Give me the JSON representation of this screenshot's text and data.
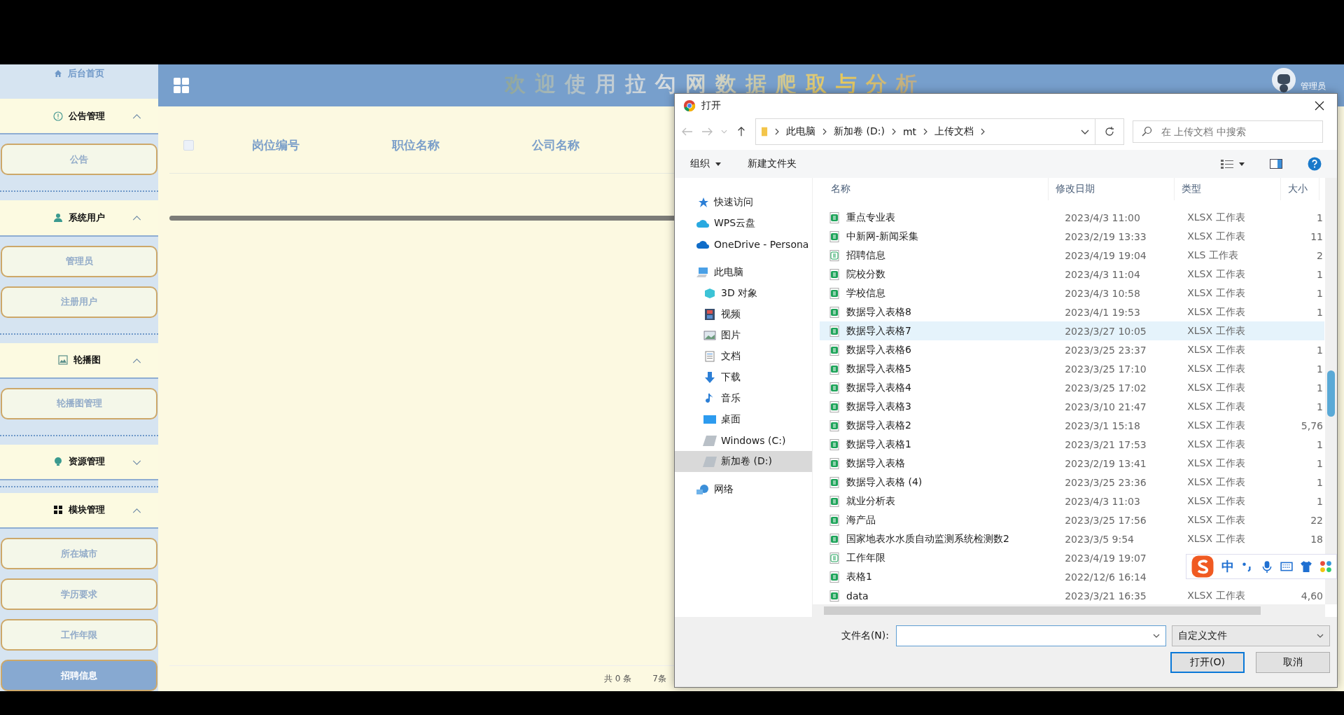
{
  "sidebar": {
    "home": {
      "label": "后台首页"
    },
    "groups": [
      {
        "label": "公告管理",
        "expanded": true,
        "children": [
          {
            "label": "公告",
            "selected": false
          }
        ]
      },
      {
        "label": "系统用户",
        "expanded": true,
        "children": [
          {
            "label": "管理员",
            "selected": false
          },
          {
            "label": "注册用户",
            "selected": false
          }
        ]
      },
      {
        "label": "轮播图",
        "expanded": true,
        "children": [
          {
            "label": "轮播图管理",
            "selected": false
          }
        ]
      },
      {
        "label": "资源管理",
        "expanded": false
      },
      {
        "label": "模块管理",
        "expanded": true,
        "children": [
          {
            "label": "所在城市",
            "selected": false
          },
          {
            "label": "学历要求",
            "selected": false
          },
          {
            "label": "工作年限",
            "selected": false
          },
          {
            "label": "招聘信息",
            "selected": true
          }
        ]
      }
    ]
  },
  "header": {
    "title": "欢迎使用拉勾网数据爬取与分析",
    "user": "管理员"
  },
  "table": {
    "columns": [
      "岗位编号",
      "职位名称",
      "公司名称"
    ],
    "select_all": {
      "checked": false
    }
  },
  "pagination": {
    "total": "共 0 条",
    "page_size": "7条"
  },
  "dialog": {
    "title": "打开",
    "breadcrumb": [
      "此电脑",
      "新加卷 (D:)",
      "mt",
      "上传文档"
    ],
    "search_placeholder": "在 上传文档 中搜索",
    "toolbar": {
      "organize": "组织",
      "new_folder": "新建文件夹"
    },
    "nav": [
      {
        "label": "快速访问",
        "selected": false
      },
      {
        "label": "WPS云盘",
        "selected": false
      },
      {
        "label": "OneDrive - Persona",
        "selected": false
      },
      {
        "label": "此电脑",
        "selected": false,
        "children": [
          {
            "label": "3D 对象",
            "selected": false
          },
          {
            "label": "视频",
            "selected": false
          },
          {
            "label": "图片",
            "selected": false
          },
          {
            "label": "文档",
            "selected": false
          },
          {
            "label": "下载",
            "selected": false
          },
          {
            "label": "音乐",
            "selected": false
          },
          {
            "label": "桌面",
            "selected": false
          },
          {
            "label": "Windows (C:)",
            "selected": false
          },
          {
            "label": "新加卷 (D:)",
            "selected": true
          }
        ]
      },
      {
        "label": "网络",
        "selected": false
      }
    ],
    "columns": [
      "名称",
      "修改日期",
      "类型",
      "大小"
    ],
    "files": [
      {
        "name": "重点专业表",
        "date": "2023/4/3 11:00",
        "type": "XLSX 工作表",
        "size": "1",
        "kind": "xlsx",
        "selected": false
      },
      {
        "name": "中新网-新闻采集",
        "date": "2023/2/19 13:33",
        "type": "XLSX 工作表",
        "size": "11",
        "kind": "xlsx",
        "selected": false
      },
      {
        "name": "招聘信息",
        "date": "2023/4/19 19:04",
        "type": "XLS 工作表",
        "size": "2",
        "kind": "xls",
        "selected": false
      },
      {
        "name": "院校分数",
        "date": "2023/4/3 11:04",
        "type": "XLSX 工作表",
        "size": "1",
        "kind": "xlsx",
        "selected": false
      },
      {
        "name": "学校信息",
        "date": "2023/4/3 10:58",
        "type": "XLSX 工作表",
        "size": "1",
        "kind": "xlsx",
        "selected": false
      },
      {
        "name": "数据导入表格8",
        "date": "2023/4/1 19:53",
        "type": "XLSX 工作表",
        "size": "1",
        "kind": "xlsx",
        "selected": false
      },
      {
        "name": "数据导入表格7",
        "date": "2023/3/27 10:05",
        "type": "XLSX 工作表",
        "kind": "xlsx",
        "selected": true
      },
      {
        "name": "数据导入表格6",
        "date": "2023/3/25 23:37",
        "type": "XLSX 工作表",
        "size": "1",
        "kind": "xlsx",
        "selected": false
      },
      {
        "name": "数据导入表格5",
        "date": "2023/3/25 17:10",
        "type": "XLSX 工作表",
        "size": "1",
        "kind": "xlsx",
        "selected": false
      },
      {
        "name": "数据导入表格4",
        "date": "2023/3/25 17:02",
        "type": "XLSX 工作表",
        "size": "1",
        "kind": "xlsx",
        "selected": false
      },
      {
        "name": "数据导入表格3",
        "date": "2023/3/10 21:47",
        "type": "XLSX 工作表",
        "size": "1",
        "kind": "xlsx",
        "selected": false
      },
      {
        "name": "数据导入表格2",
        "date": "2023/3/1 15:18",
        "type": "XLSX 工作表",
        "size": "5,76",
        "kind": "xlsx",
        "selected": false
      },
      {
        "name": "数据导入表格1",
        "date": "2023/3/21 17:53",
        "type": "XLSX 工作表",
        "size": "1",
        "kind": "xlsx",
        "selected": false
      },
      {
        "name": "数据导入表格",
        "date": "2023/2/19 13:41",
        "type": "XLSX 工作表",
        "size": "1",
        "kind": "xlsx",
        "selected": false
      },
      {
        "name": "数据导入表格 (4)",
        "date": "2023/3/25 23:36",
        "type": "XLSX 工作表",
        "size": "1",
        "kind": "xlsx",
        "selected": false
      },
      {
        "name": "就业分析表",
        "date": "2023/4/3 11:03",
        "type": "XLSX 工作表",
        "size": "1",
        "kind": "xlsx",
        "selected": false
      },
      {
        "name": "海产品",
        "date": "2023/3/25 17:56",
        "type": "XLSX 工作表",
        "size": "22",
        "kind": "xlsx",
        "selected": false
      },
      {
        "name": "国家地表水水质自动监测系统检测数2",
        "date": "2023/3/5 9:54",
        "type": "XLSX 工作表",
        "size": "18",
        "kind": "xlsx",
        "selected": false
      },
      {
        "name": "工作年限",
        "date": "2023/4/19 19:07",
        "kind": "xls",
        "selected": false
      },
      {
        "name": "表格1",
        "date": "2022/12/6 16:14",
        "kind": "xlsx",
        "selected": false
      },
      {
        "name": "data",
        "date": "2023/3/21 16:35",
        "type": "XLSX 工作表",
        "size": "4,60",
        "kind": "xlsx",
        "selected": false
      }
    ],
    "filename_label": "文件名(N):",
    "filter": "自定义文件",
    "buttons": [
      "打开(O)",
      "取消"
    ]
  },
  "ime": {
    "mode": "中"
  }
}
